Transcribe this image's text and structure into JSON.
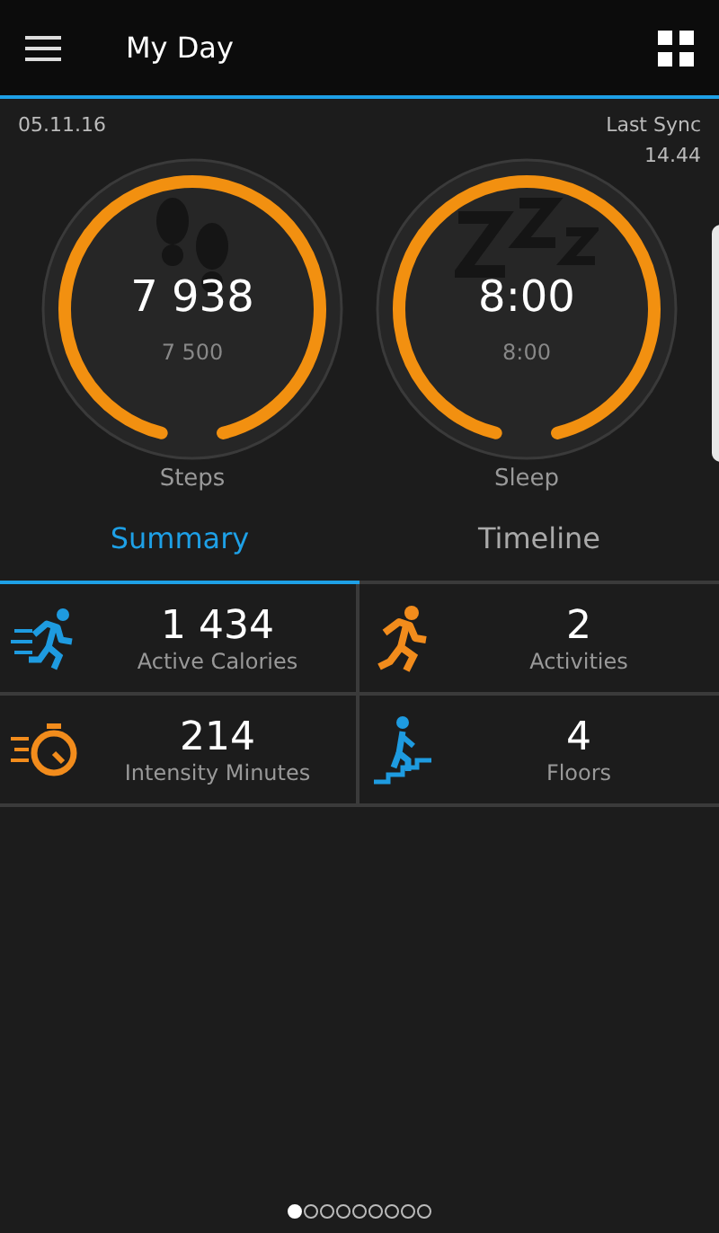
{
  "header": {
    "title": "My Day"
  },
  "date": "05.11.16",
  "sync": {
    "label": "Last Sync",
    "time": "14.44"
  },
  "gauges": [
    {
      "kind": "steps",
      "value": "7 938",
      "goal": "7 500",
      "label": "Steps",
      "level": 1
    },
    {
      "kind": "sleep",
      "value": "8:00",
      "goal": "8:00",
      "label": "Sleep",
      "level": 1
    }
  ],
  "tabs": [
    {
      "label": "Summary",
      "selected": true
    },
    {
      "label": "Timeline",
      "selected": false
    }
  ],
  "stats": [
    {
      "kind": "calories",
      "color": "#1e9be0",
      "value": "1 434",
      "label": "Active Calories"
    },
    {
      "kind": "activities",
      "color": "#f28c1c",
      "value": "2",
      "label": "Activities"
    },
    {
      "kind": "intensity",
      "color": "#f28c1c",
      "value": "214",
      "label": "Intensity Minutes"
    },
    {
      "kind": "floors",
      "color": "#1e9be0",
      "value": "4",
      "label": "Floors"
    }
  ],
  "pages": [
    {
      "selected": true
    },
    {
      "selected": false
    },
    {
      "selected": false
    },
    {
      "selected": false
    },
    {
      "selected": false
    },
    {
      "selected": false
    },
    {
      "selected": false
    },
    {
      "selected": false
    },
    {
      "selected": false
    }
  ]
}
